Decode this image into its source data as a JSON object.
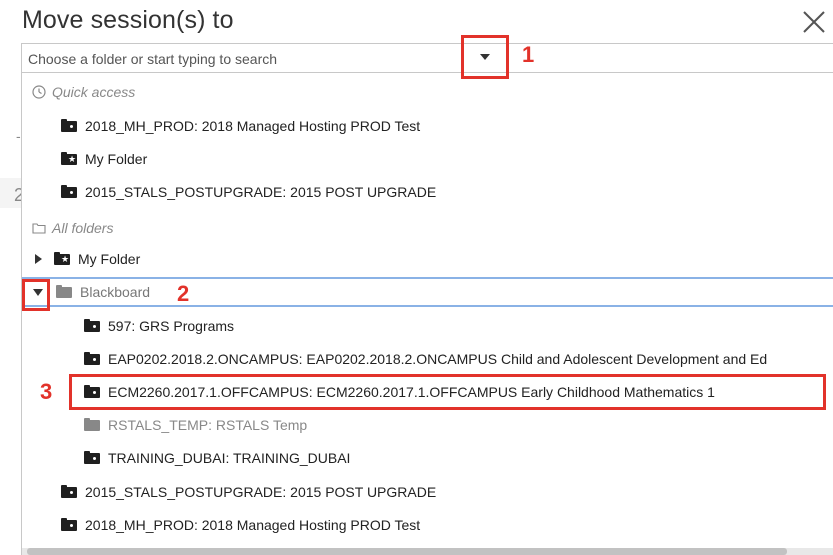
{
  "dialog": {
    "title": "Move session(s) to",
    "search_placeholder": "Choose a folder or start typing to search"
  },
  "callouts": [
    "1",
    "2",
    "3"
  ],
  "quick_access": {
    "label": "Quick access",
    "items": [
      "2018_MH_PROD: 2018 Managed Hosting PROD Test",
      "My Folder",
      "2015_STALS_POSTUPGRADE: 2015 POST UPGRADE"
    ]
  },
  "all_folders": {
    "label": "All folders",
    "my_folder": "My Folder",
    "blackboard": "Blackboard",
    "children": [
      "597: GRS Programs",
      "EAP0202.2018.2.ONCAMPUS: EAP0202.2018.2.ONCAMPUS Child and Adolescent Development and Ed",
      "ECM2260.2017.1.OFFCAMPUS: ECM2260.2017.1.OFFCAMPUS Early Childhood Mathematics 1",
      "RSTALS_TEMP: RSTALS Temp",
      "TRAINING_DUBAI: TRAINING_DUBAI"
    ],
    "more": [
      "2015_STALS_POSTUPGRADE: 2015 POST UPGRADE",
      "2018_MH_PROD: 2018 Managed Hosting PROD Test"
    ]
  },
  "background_glyphs": [
    "-",
    "2"
  ],
  "colors": {
    "callout": "#e2322a",
    "selection_border": "#8ab2e6"
  }
}
